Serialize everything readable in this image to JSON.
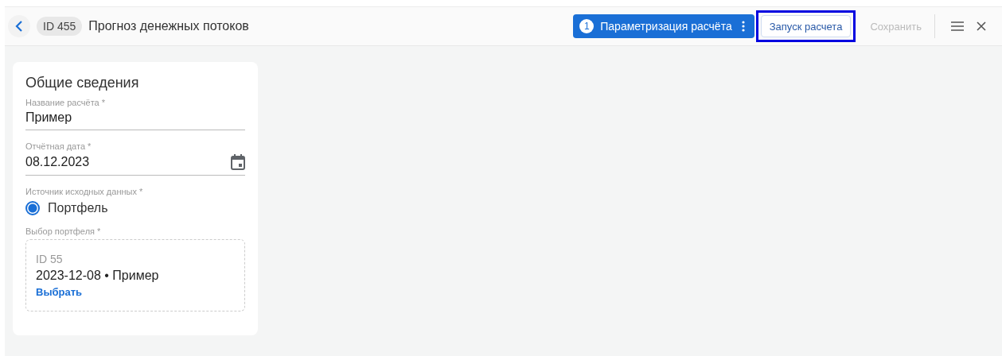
{
  "header": {
    "id_badge": "ID 455",
    "title": "Прогноз денежных потоков",
    "step": {
      "number": "1",
      "label": "Параметризация расчёта"
    },
    "buttons": [
      {
        "label": "Запуск расчета",
        "kind": "outlined",
        "highlighted": true,
        "disabled": false
      },
      {
        "label": "Сохранить",
        "kind": "text",
        "highlighted": false,
        "disabled": true
      }
    ]
  },
  "card": {
    "title": "Общие сведения",
    "fields": [
      {
        "kind": "text",
        "label": "Название расчёта *",
        "value": "Пример"
      },
      {
        "kind": "date",
        "label": "Отчётная дата *",
        "value": "08.12.2023"
      },
      {
        "kind": "radio",
        "label": "Источник исходных данных *",
        "options": [
          {
            "label": "Портфель",
            "selected": true
          }
        ]
      },
      {
        "kind": "picker",
        "label": "Выбор портфеля *",
        "id": "ID 55",
        "value": "2023-12-08 • Пример",
        "action": "Выбрать"
      }
    ]
  }
}
